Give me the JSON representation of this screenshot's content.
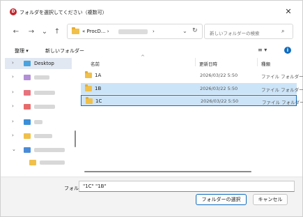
{
  "window": {
    "title": "フォルダを選択してください（複数可）",
    "app_icon_letter": "D",
    "close_glyph": "✕"
  },
  "nav": {
    "back": "←",
    "forward": "→",
    "recent": "⌄",
    "up": "↑",
    "address_prefix": "« ProcD...  ›",
    "address_sep": "›",
    "address_dropdown": "⌄",
    "refresh": "↻",
    "search_placeholder": "新しいフォルダーの検索",
    "search_glyph": "⌕"
  },
  "toolbar": {
    "organize": "整理 ▾",
    "new_folder": "新しいフォルダー",
    "view": "≡ ▾",
    "info": "i"
  },
  "sidebar": {
    "items": [
      {
        "label": "Desktop",
        "chevron": "›",
        "selected": true,
        "icon_color": "#4aa3df"
      },
      {
        "label": "",
        "chevron": "›",
        "icon_color": "#b28fd6"
      },
      {
        "label": "",
        "chevron": "›",
        "icon_color": "#e7737d"
      },
      {
        "label": "",
        "chevron": "›",
        "icon_color": "#e76b6b"
      },
      {
        "label": "",
        "chevron": "›",
        "icon_color": "#3a8fd8"
      },
      {
        "label": "",
        "chevron": "›",
        "icon_color": "#f0c04a"
      },
      {
        "label": "",
        "chevron": "⌄",
        "icon_color": "#4a8bd8"
      },
      {
        "label": "",
        "chevron": "",
        "icon_color": "#f0c04a"
      }
    ]
  },
  "columns": {
    "name": "名前",
    "date": "更新日時",
    "type": "種類",
    "sort_indicator": "^"
  },
  "files": [
    {
      "name": "1A",
      "date": "2026/03/22 5:50",
      "type": "ファイル フォルダー",
      "selected": false
    },
    {
      "name": "1B",
      "date": "2026/03/22 5:50",
      "type": "ファイル フォルダー",
      "selected": true
    },
    {
      "name": "1C",
      "date": "2026/03/22 5:50",
      "type": "ファイル フォルダー",
      "selected": true
    }
  ],
  "footer": {
    "folder_label": "フォルダー:",
    "folder_value": "\"1C\" \"1B\"",
    "select_button": "フォルダーの選択",
    "cancel_button": "キャンセル"
  },
  "colors": {
    "accent": "#0f6cbd",
    "selection": "#cce4f7",
    "folder": "#f0c04a",
    "app_icon": "#c4262e"
  }
}
